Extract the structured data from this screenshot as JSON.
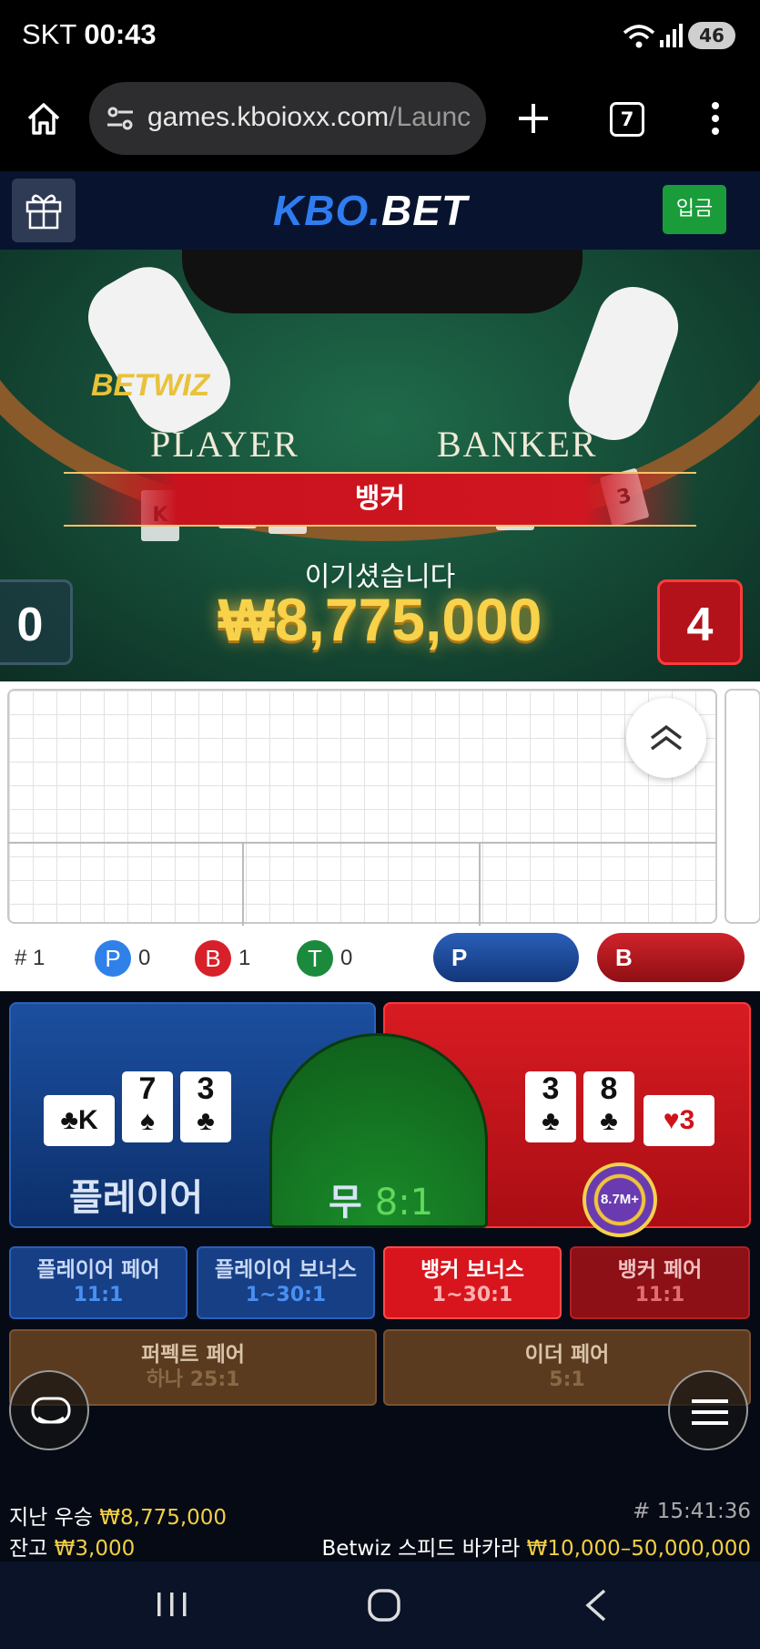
{
  "status_bar": {
    "carrier": "SKT",
    "time": "00:43",
    "battery": "46"
  },
  "browser": {
    "url_host": "games.kboioxx.com",
    "url_path": "/Launc",
    "tab_count": "7"
  },
  "header": {
    "logo_a": "KBO.",
    "logo_b": "BET",
    "deposit_label": "입금"
  },
  "video": {
    "table_brand": "BETWIZ",
    "player_label": "PLAYER",
    "banker_label": "BANKER",
    "result_label": "뱅커",
    "win_message": "이기셨습니다",
    "win_amount": "₩8,775,000",
    "player_score": "0",
    "banker_score": "4"
  },
  "roadmap": {
    "round": "# 1",
    "p_label": "P",
    "p_count": "0",
    "b_label": "B",
    "b_count": "1",
    "t_label": "T",
    "t_count": "0",
    "predict_p": "P",
    "predict_b": "B"
  },
  "bets": {
    "player_label": "플레이어",
    "tie_label": "무",
    "tie_odds": "8:1",
    "player_cards": [
      {
        "rank": "K",
        "suit": "♣",
        "orientation": "sideways"
      },
      {
        "rank": "7",
        "suit": "♠"
      },
      {
        "rank": "3",
        "suit": "♣"
      }
    ],
    "banker_cards": [
      {
        "rank": "3",
        "suit": "♣"
      },
      {
        "rank": "8",
        "suit": "♣"
      },
      {
        "rank": "3",
        "suit": "♥",
        "orientation": "sideways"
      }
    ],
    "chip_value": "8.7M+",
    "side_bets": [
      {
        "label": "플레이어 페어",
        "odds": "11:1"
      },
      {
        "label": "플레이어 보너스",
        "odds": "1~30:1"
      },
      {
        "label": "뱅커 보너스",
        "odds": "1~30:1"
      },
      {
        "label": "뱅커 페어",
        "odds": "11:1"
      }
    ],
    "perfect_pair": {
      "label": "퍼펙트 페어",
      "odds": "하나 25:1"
    },
    "either_pair": {
      "label": "이더 페어",
      "odds": "5:1"
    }
  },
  "footer": {
    "last_win_label": "지난 우승",
    "last_win_amount": "₩8,775,000",
    "balance_label": "잔고",
    "balance_amount": "₩3,000",
    "round_time": "# 15:41:36",
    "game_name": "Betwiz 스피드 바카라",
    "limits": "₩10,000–50,000,000"
  },
  "colors": {
    "player_blue": "#1c4fa0",
    "banker_red": "#d81b22",
    "tie_green": "#1a8c2a",
    "gold": "#f3cf43",
    "deposit_green": "#1a9c3a"
  }
}
